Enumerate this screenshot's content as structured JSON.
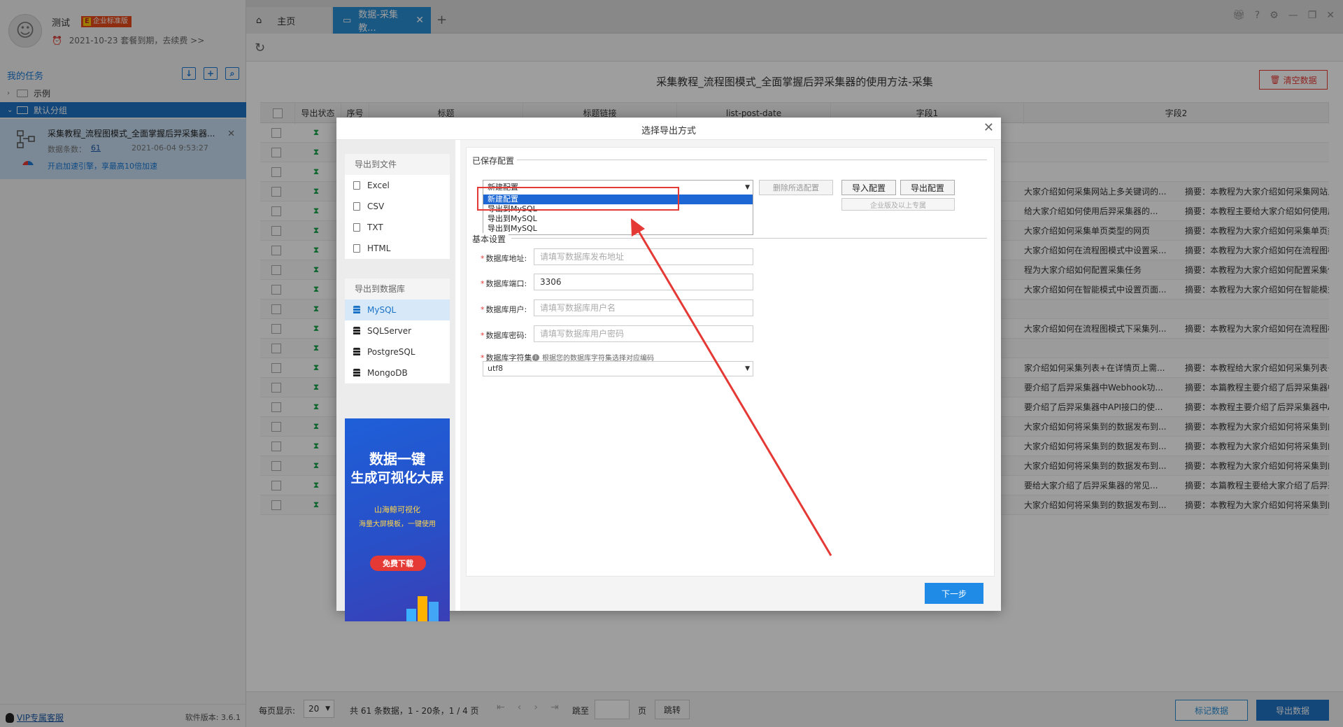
{
  "sidebar": {
    "user_name": "测试",
    "edition_badge": "企业标准版",
    "edition_letter": "E",
    "expire_text": "2021-10-23 套餐到期，去续费 >>",
    "tasks_title": "我的任务",
    "tree": {
      "example": "示例",
      "default_group": "默认分组"
    },
    "task": {
      "title": "采集教程_流程图模式_全面掌握后羿采集器...",
      "count_label": "数据条数：",
      "count": "61",
      "time": "2021-06-04 9:53:27",
      "speed_text": "开启加速引擎，享最高10倍加速"
    },
    "vip_link": "VIP专属客服",
    "version": "软件版本: 3.6.1"
  },
  "tabs": {
    "home": "主页",
    "data": "数据-采集教...",
    "add": "+"
  },
  "main": {
    "title": "采集教程_流程图模式_全面掌握后羿采集器的使用方法-采集",
    "clear_button": "清空数据",
    "columns": [
      "",
      "导出状态",
      "序号",
      "标题",
      "标题链接",
      "list-post-date",
      "字段1",
      "字段2"
    ],
    "rows": [
      {
        "f1": "",
        "f2": ""
      },
      {
        "f1": "",
        "f2": ""
      },
      {
        "f1": "",
        "f2": ""
      },
      {
        "f1": "大家介绍如何采集网站上多关键词的...",
        "f2": "摘要：本教程为大家介绍如何采集网站上多关键..."
      },
      {
        "f1": "给大家介绍如何使用后羿采集器的...",
        "f2": "摘要：本教程主要给大家介绍如何使用后羿采集..."
      },
      {
        "f1": "大家介绍如何采集单页类型的网页",
        "f2": "摘要：本教程为大家介绍如何采集单页类型的网..."
      },
      {
        "f1": "大家介绍如何在流程图模式中设置采...",
        "f2": "摘要：本教程为大家介绍如何在流程图模式中设..."
      },
      {
        "f1": "程为大家介绍如何配置采集任务",
        "f2": "摘要：本教程为大家介绍如何配置采集任务 免..."
      },
      {
        "f1": "大家介绍如何在智能模式中设置页面...",
        "f2": "摘要：本教程为大家介绍如何在智能模式中设置..."
      },
      {
        "f1": "",
        "f2": ""
      },
      {
        "f1": "大家介绍如何在流程图模式下采集列...",
        "f2": "摘要：本教程为大家介绍如何在流程图模式下采..."
      },
      {
        "f1": "",
        "f2": ""
      },
      {
        "f1": "家介绍如何采集列表+在详情页上需...",
        "f2": "摘要：本教程给大家介绍如何采集列表+在详情..."
      },
      {
        "f1": "要介绍了后羿采集器中Webhook功...",
        "f2": "摘要：本篇教程主要介绍了后羿采集器中Webh..."
      },
      {
        "f1": "要介绍了后羿采集器中API接口的使...",
        "f2": "摘要：本教程主要介绍了后羿采集器中API接..."
      },
      {
        "f1": "大家介绍如何将采集到的数据发布到...",
        "f2": "摘要：本教程为大家介绍如何将采集到的数据发..."
      },
      {
        "f1": "大家介绍如何将采集到的数据发布到...",
        "f2": "摘要：本教程为大家介绍如何将采集到的数据发..."
      },
      {
        "f1": "大家介绍如何将采集到的数据发布到...",
        "f2": "摘要：本教程为大家介绍如何将采集到的数据发..."
      },
      {
        "f1": "要给大家介绍了后羿采集器的常见...",
        "f2": "摘要：本篇教程主要给大家介绍了后羿采集器的..."
      },
      {
        "f1": "大家介绍如何将采集到的数据发布到...",
        "f2": "摘要：本教程为大家介绍如何将采集到的数据发..."
      }
    ]
  },
  "pager": {
    "per_page_label": "每页显示:",
    "per_page_value": "20",
    "summary": "共 61 条数据，1 - 20条，1 / 4 页",
    "jump_label": "跳至",
    "page_unit": "页",
    "jump_button": "跳转",
    "mark_button": "标记数据",
    "export_button": "导出数据"
  },
  "dialog": {
    "title": "选择导出方式",
    "file_group_title": "导出到文件",
    "file_items": [
      "Excel",
      "CSV",
      "TXT",
      "HTML"
    ],
    "db_group_title": "导出到数据库",
    "db_items": [
      "MySQL",
      "SQLServer",
      "PostgreSQL",
      "MongoDB"
    ],
    "promo": {
      "line1": "数据一键",
      "line2": "生成可视化大屏",
      "brand": "山海鲸可视化",
      "tagline": "海量大屏模板，一键使用",
      "button": "免费下载"
    },
    "saved_config_title": "已保存配置",
    "config_selected": "新建配置",
    "config_options": [
      "新建配置",
      "导出到MySQL",
      "导出到MySQL",
      "导出到MySQL"
    ],
    "delete_config_button": "删除所选配置",
    "import_config_button": "导入配置",
    "export_config_button": "导出配置",
    "enterprise_hint": "企业版及以上专属",
    "basic_title": "基本设置",
    "fields": {
      "host_label": "数据库地址:",
      "host_placeholder": "请填写数据库发布地址",
      "port_label": "数据库端口:",
      "port_value": "3306",
      "user_label": "数据库用户:",
      "user_placeholder": "请填写数据库用户名",
      "password_label": "数据库密码:",
      "password_placeholder": "请填写数据库用户密码",
      "charset_label": "数据库字符集:",
      "charset_hint": "根据您的数据库字符集选择对应编码",
      "charset_value": "utf8"
    },
    "next_button": "下一步"
  }
}
